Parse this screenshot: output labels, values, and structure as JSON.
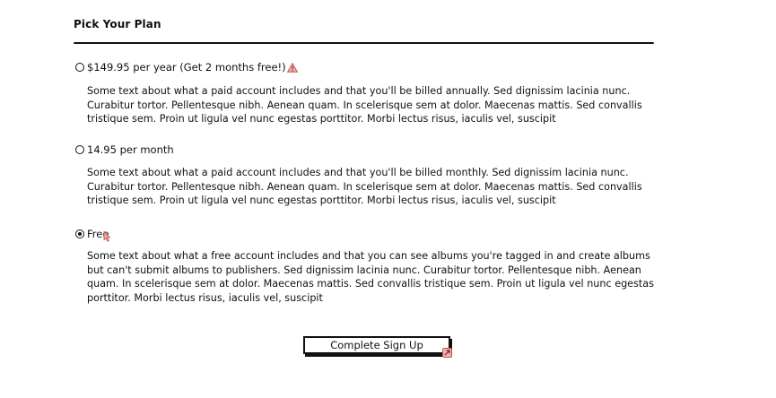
{
  "page": {
    "title": "Pick Your Plan"
  },
  "plans": [
    {
      "label": "$149.95 per year (Get 2 months free!)",
      "selected": false,
      "description": "Some text about what a paid account includes and that you'll be billed annually.  Sed dignissim lacinia nunc.\nCurabitur tortor. Pellentesque nibh. Aenean quam. In scelerisque sem at dolor. Maecenas mattis. Sed convallis\ntristique sem. Proin ut ligula vel nunc egestas porttitor. Morbi lectus risus, iaculis vel, suscipit"
    },
    {
      "label": "14.95 per month",
      "selected": false,
      "description": "Some text about what a paid account includes and that you'll be billed monthly.  Sed dignissim lacinia nunc.\nCurabitur tortor. Pellentesque nibh. Aenean quam. In scelerisque sem at dolor. Maecenas mattis. Sed convallis\ntristique sem. Proin ut ligula vel nunc egestas porttitor. Morbi lectus risus, iaculis vel, suscipit"
    },
    {
      "label": "Free",
      "selected": true,
      "description": "Some text about what a free account includes and that you can see albums you're tagged in and create albums\nbut can't submit albums to publishers.  Sed dignissim lacinia nunc. Curabitur tortor. Pellentesque nibh. Aenean\nquam. In scelerisque sem at dolor. Maecenas mattis. Sed convallis tristique sem. Proin ut ligula vel nunc egestas\nporttitor. Morbi lectus risus, iaculis vel, suscipit"
    }
  ],
  "actions": {
    "signup_label": "Complete Sign Up"
  },
  "icons": {
    "warning": "warning-icon",
    "cursor": "cursor-icon",
    "link": "link-icon"
  },
  "colors": {
    "text": "#111111",
    "annotation": "#d9534f",
    "background": "#ffffff"
  }
}
